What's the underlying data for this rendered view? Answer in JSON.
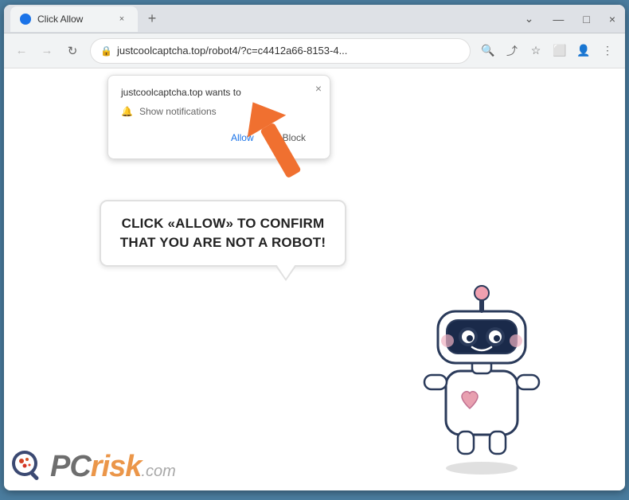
{
  "browser": {
    "title_bar": {
      "tab_title": "Click Allow",
      "tab_close": "×",
      "new_tab": "+",
      "window_controls": {
        "chevron_down": "⌄",
        "minimize": "—",
        "maximize": "□",
        "close": "×"
      }
    },
    "nav_bar": {
      "back_arrow": "←",
      "forward_arrow": "→",
      "refresh": "↻",
      "lock_icon": "🔒",
      "address": "justcoolcaptcha.top/robot4/?c=c4412a66-8153-4...",
      "search_icon": "🔍",
      "share_icon": "⤴",
      "bookmark_icon": "☆",
      "extension_icon": "⬜",
      "account_icon": "👤",
      "more_icon": "⋮"
    }
  },
  "notification_popup": {
    "title": "justcoolcaptcha.top wants to",
    "desc": "Show notifications",
    "allow_label": "Allow",
    "block_label": "Block",
    "close": "×"
  },
  "speech_bubble": {
    "text": "CLICK «ALLOW» TO CONFIRM THAT YOU ARE NOT A ROBOT!"
  },
  "watermark": {
    "pc": "PC",
    "risk": "risk",
    "com": ".com"
  },
  "colors": {
    "orange_arrow": "#f07030",
    "accent_blue": "#1a73e8",
    "border_gray": "#5a88a8"
  }
}
